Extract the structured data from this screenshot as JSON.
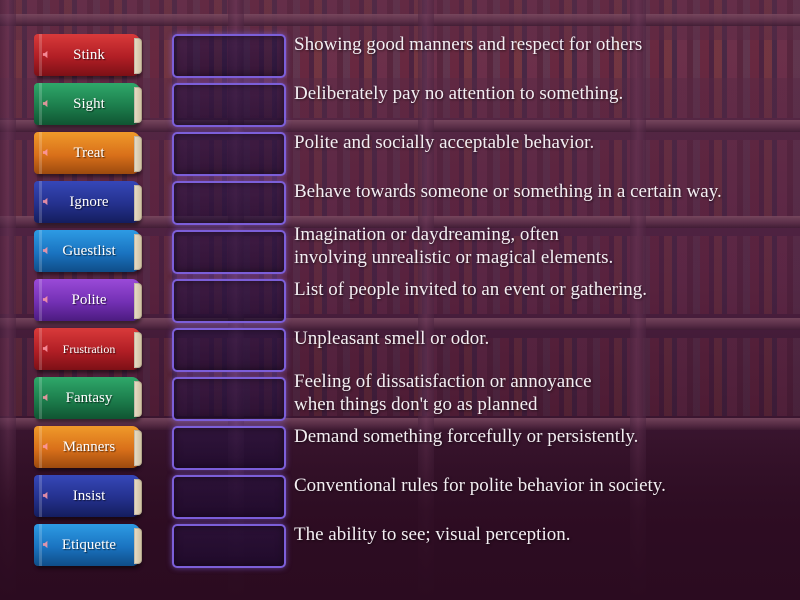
{
  "rows": [
    {
      "word": "Stink",
      "color": "red",
      "definition": [
        "Showing good manners and respect for others"
      ]
    },
    {
      "word": "Sight",
      "color": "green",
      "definition": [
        "Deliberately pay no attention to something."
      ]
    },
    {
      "word": "Treat",
      "color": "orange",
      "definition": [
        "Polite and socially acceptable behavior."
      ]
    },
    {
      "word": "Ignore",
      "color": "navy",
      "definition": [
        "Behave towards someone or something in a certain way."
      ]
    },
    {
      "word": "Guestlist",
      "color": "cyan",
      "definition": [
        "Imagination or daydreaming, often",
        "involving unrealistic or magical elements."
      ]
    },
    {
      "word": "Polite",
      "color": "purple",
      "definition": [
        "List of people invited to an event or gathering."
      ]
    },
    {
      "word": "Frustration",
      "color": "red",
      "definition": [
        "Unpleasant smell or odor."
      ]
    },
    {
      "word": "Fantasy",
      "color": "green",
      "definition": [
        "Feeling of dissatisfaction or annoyance",
        "when things don't go as planned"
      ]
    },
    {
      "word": "Manners",
      "color": "orange",
      "definition": [
        "Demand something forcefully or persistently."
      ]
    },
    {
      "word": "Insist",
      "color": "navy",
      "definition": [
        "Conventional rules for polite behavior in society."
      ]
    },
    {
      "word": "Etiquette",
      "color": "cyan",
      "definition": [
        "The ability to see; visual perception."
      ]
    }
  ],
  "icons": {
    "book_sound": "speaker-icon"
  },
  "colors": {
    "slot_border": "#7c5fd9",
    "text": "#f3eef2"
  }
}
